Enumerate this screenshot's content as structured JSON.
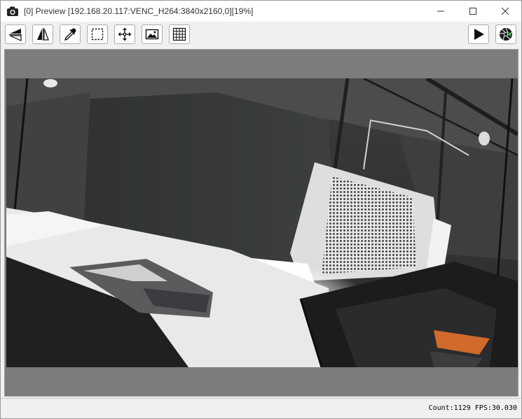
{
  "window": {
    "title": "[0] Preview [192.168.20.117:VENC_H264:3840x2160,0][19%]",
    "controls": {
      "minimize": "—",
      "maximize": "☐",
      "close": "✕"
    }
  },
  "toolbar": {
    "tools": [
      {
        "name": "flip-vertical-icon"
      },
      {
        "name": "mirror-horizontal-icon"
      },
      {
        "name": "eyedropper-icon"
      },
      {
        "name": "select-region-icon"
      },
      {
        "name": "move-icon"
      },
      {
        "name": "image-icon"
      },
      {
        "name": "grid-icon"
      }
    ],
    "right_tools": [
      {
        "name": "play-icon"
      },
      {
        "name": "aperture-icon"
      }
    ]
  },
  "status": {
    "text": "Count:1129 FPS:30.030"
  },
  "colors": {
    "preview_background": "#7c7c7c",
    "accent_green": "#2fb34a"
  }
}
